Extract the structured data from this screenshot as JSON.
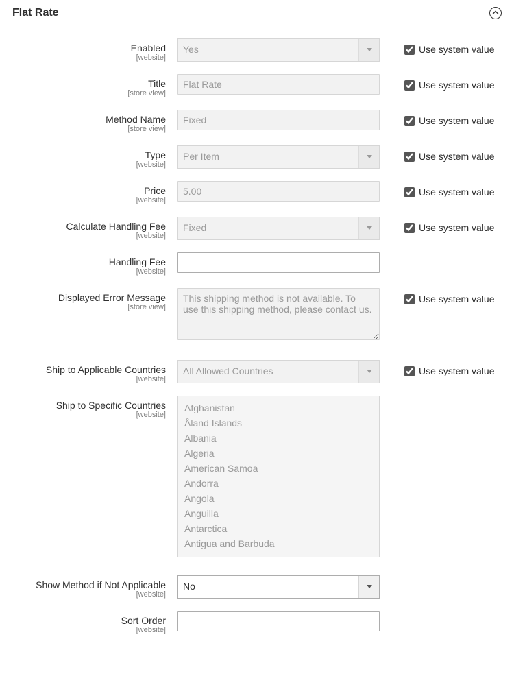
{
  "section_title": "Flat Rate",
  "system_label": "Use system value",
  "scope_website": "[website]",
  "scope_storeview": "[store view]",
  "fields": {
    "enabled": {
      "label": "Enabled",
      "value": "Yes"
    },
    "title": {
      "label": "Title",
      "value": "Flat Rate"
    },
    "method": {
      "label": "Method Name",
      "value": "Fixed"
    },
    "type": {
      "label": "Type",
      "value": "Per Item"
    },
    "price": {
      "label": "Price",
      "value": "5.00"
    },
    "calcfee": {
      "label": "Calculate Handling Fee",
      "value": "Fixed"
    },
    "handlefee": {
      "label": "Handling Fee",
      "value": ""
    },
    "errmsg": {
      "label": "Displayed Error Message",
      "value": "This shipping method is not available. To use this shipping method, please contact us."
    },
    "applic": {
      "label": "Ship to Applicable Countries",
      "value": "All Allowed Countries"
    },
    "specific": {
      "label": "Ship to Specific Countries"
    },
    "showmethod": {
      "label": "Show Method if Not Applicable",
      "value": "No"
    },
    "sortorder": {
      "label": "Sort Order",
      "value": ""
    }
  },
  "countries": [
    "Afghanistan",
    "Åland Islands",
    "Albania",
    "Algeria",
    "American Samoa",
    "Andorra",
    "Angola",
    "Anguilla",
    "Antarctica",
    "Antigua and Barbuda"
  ]
}
